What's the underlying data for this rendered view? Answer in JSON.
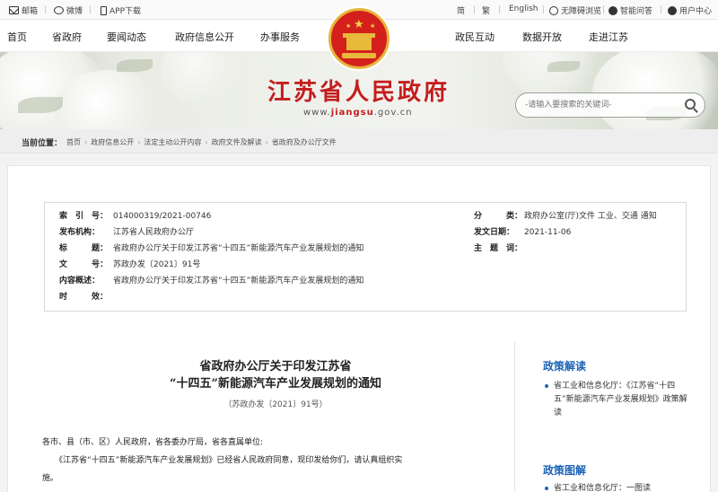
{
  "topbar": {
    "mail": "邮箱",
    "weibo": "微博",
    "app": "APP下载",
    "lang_simplified": "简",
    "lang_traditional": "繁",
    "english": "English",
    "accessible": "无障碍浏览",
    "smart_qa": "智能问答",
    "user_center": "用户中心"
  },
  "nav": {
    "left": [
      "首页",
      "省政府",
      "要闻动态",
      "政府信息公开",
      "办事服务"
    ],
    "right": [
      "政民互动",
      "数据开放",
      "走进江苏"
    ]
  },
  "header": {
    "site_title": "江苏省人民政府",
    "url_prefix": "www.",
    "url_domain": "jiangsu",
    "url_suffix": ".gov.cn",
    "search_placeholder": "-请输入要搜索的关键词-"
  },
  "breadcrumb": {
    "label": "当前位置：",
    "items": [
      "首页",
      "政府信息公开",
      "法定主动公开内容",
      "政府文件及解读",
      "省政府及办公厅文件"
    ]
  },
  "meta": {
    "index_no_label": "索　引　号：",
    "index_no": "014000319/2021-00746",
    "category_label": "分　　　类：",
    "category": "政府办公室(厅)文件  工业、交通  通知",
    "issuer_label": "发布机构：",
    "issuer": "江苏省人民政府办公厅",
    "date_label": "发文日期：",
    "date": "2021-11-06",
    "title_label": "标　　　题：",
    "title": "省政府办公厅关于印发江苏省“十四五”新能源汽车产业发展规划的通知",
    "subject_label": "主　题　词：",
    "subject": "",
    "doc_no_label": "文　　　号：",
    "doc_no": "苏政办发〔2021〕91号",
    "summary_label": "内容概述：",
    "summary": "省政府办公厅关于印发江苏省“十四五”新能源汽车产业发展规划的通知",
    "validity_label": "时　　　效：",
    "validity": ""
  },
  "document": {
    "title_line1": "省政府办公厅关于印发江苏省",
    "title_line2": "“十四五”新能源汽车产业发展规划的通知",
    "doc_no": "（苏政办发〔2021〕91号）",
    "para1": "各市、县（市、区）人民政府，省各委办厅局，省各直属单位:",
    "para2": "《江苏省“十四五”新能源汽车产业发展规划》已经省人民政府同意，现印发给你们，请认真组织实",
    "para3": "施。"
  },
  "sidebar": {
    "heading1": "政策解读",
    "item1": "省工业和信息化厅：《江苏省“十四五”新能源汽车产业发展规划》政策解读",
    "heading2": "政策图解",
    "item2": "省工业和信息化厅：一图读"
  }
}
